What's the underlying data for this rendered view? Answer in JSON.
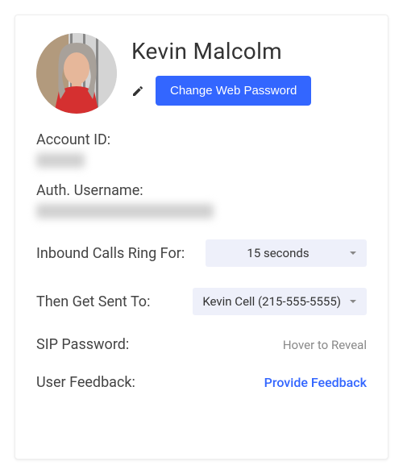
{
  "user": {
    "name": "Kevin Malcolm"
  },
  "buttons": {
    "change_password": "Change Web Password"
  },
  "fields": {
    "account_id_label": "Account ID:",
    "auth_username_label": "Auth. Username:",
    "inbound_ring_label": "Inbound Calls Ring For:",
    "inbound_ring_value": "15 seconds",
    "then_sent_label": "Then Get Sent To:",
    "then_sent_value": "Kevin Cell (215-555-5555)",
    "sip_password_label": "SIP Password:",
    "sip_password_hint": "Hover to Reveal",
    "feedback_label": "User Feedback:",
    "feedback_link": "Provide Feedback"
  }
}
